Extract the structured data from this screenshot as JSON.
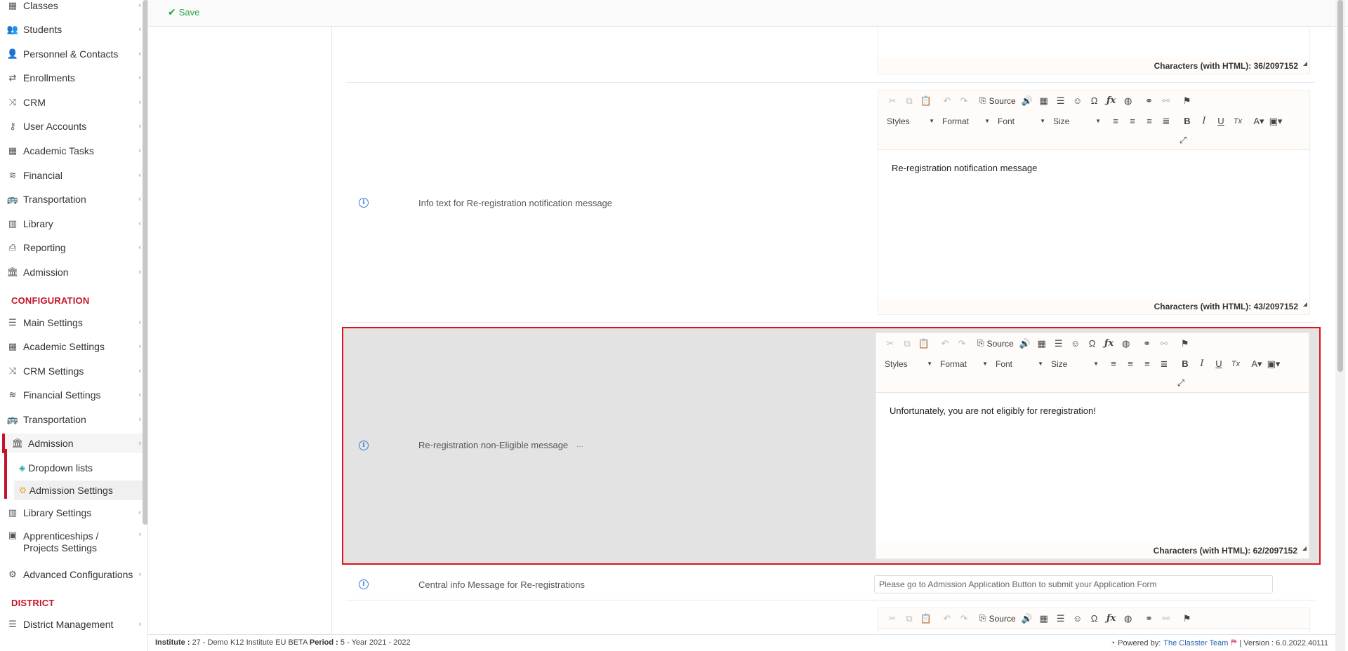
{
  "toolbar": {
    "save_label": "Save"
  },
  "sidebar": {
    "items": [
      {
        "label": "Classes",
        "icon": "classes-icon",
        "glyph": "▦"
      },
      {
        "label": "Students",
        "icon": "students-icon",
        "glyph": "👥"
      },
      {
        "label": "Personnel & Contacts",
        "icon": "personnel-icon",
        "glyph": "👤"
      },
      {
        "label": "Enrollments",
        "icon": "enrollments-icon",
        "glyph": "⇄"
      },
      {
        "label": "CRM",
        "icon": "crm-icon",
        "glyph": "⤨"
      },
      {
        "label": "User Accounts",
        "icon": "key-icon",
        "glyph": "⚷"
      },
      {
        "label": "Academic Tasks",
        "icon": "tasks-icon",
        "glyph": "▦"
      },
      {
        "label": "Financial",
        "icon": "financial-icon",
        "glyph": "≋"
      },
      {
        "label": "Transportation",
        "icon": "bus-icon",
        "glyph": "🚌"
      },
      {
        "label": "Library",
        "icon": "library-icon",
        "glyph": "▥"
      },
      {
        "label": "Reporting",
        "icon": "print-icon",
        "glyph": "⎙"
      },
      {
        "label": "Admission",
        "icon": "institution-icon",
        "glyph": "🏛"
      }
    ],
    "config_section": "CONFIGURATION",
    "config_items": [
      {
        "label": "Main Settings",
        "icon": "sliders-icon",
        "glyph": "☰"
      },
      {
        "label": "Academic Settings",
        "icon": "academic-settings-icon",
        "glyph": "▦"
      },
      {
        "label": "CRM Settings",
        "icon": "crm-settings-icon",
        "glyph": "⤨"
      },
      {
        "label": "Financial Settings",
        "icon": "financial-settings-icon",
        "glyph": "≋"
      },
      {
        "label": "Transportation",
        "icon": "bus-icon",
        "glyph": "🚌"
      },
      {
        "label": "Admission",
        "icon": "institution-icon",
        "glyph": "🏛"
      }
    ],
    "sub_items": [
      {
        "label": "Dropdown lists",
        "icon": "layers-icon",
        "glyph": "◈"
      },
      {
        "label": "Admission Settings",
        "icon": "gear-icon",
        "glyph": "⚙"
      }
    ],
    "more_items": [
      {
        "label": "Library Settings",
        "icon": "library-icon",
        "glyph": "▥"
      },
      {
        "label": "Apprenticeships / Projects Settings",
        "icon": "box-icon",
        "glyph": "▣"
      },
      {
        "label": "Advanced Configurations",
        "icon": "gears-icon",
        "glyph": "⚙"
      }
    ],
    "district_section": "DISTRICT",
    "district_items": [
      {
        "label": "District Management",
        "icon": "list-icon",
        "glyph": "☰"
      }
    ]
  },
  "editor_toolbar": {
    "source_label": "Source",
    "styles_label": "Styles",
    "format_label": "Format",
    "font_label": "Font",
    "size_label": "Size"
  },
  "rows": [
    {
      "footer": "Characters (with HTML): 36/2097152"
    },
    {
      "label": "Info text for Re-registration notification message",
      "body": "Re-registration notification message",
      "footer": "Characters (with HTML): 43/2097152"
    },
    {
      "label": "Re-registration non-Eligible message",
      "ellipsis": "···",
      "body": "Unfortunately, you are not eligibly for reregistration!",
      "footer": "Characters (with HTML): 62/2097152"
    },
    {
      "label": "Central info Message for Re-registrations",
      "value": "Please go to Admission Application Button to submit your Application Form"
    }
  ],
  "footer": {
    "institute_label": "Institute :",
    "institute_value": "27 - Demo K12 Institute EU BETA",
    "period_label": "Period :",
    "period_value": "5 - Year 2021 - 2022",
    "powered_by": "Powered by:",
    "team": "The Classter Team",
    "version": "| Version : 6.0.2022.40111"
  }
}
